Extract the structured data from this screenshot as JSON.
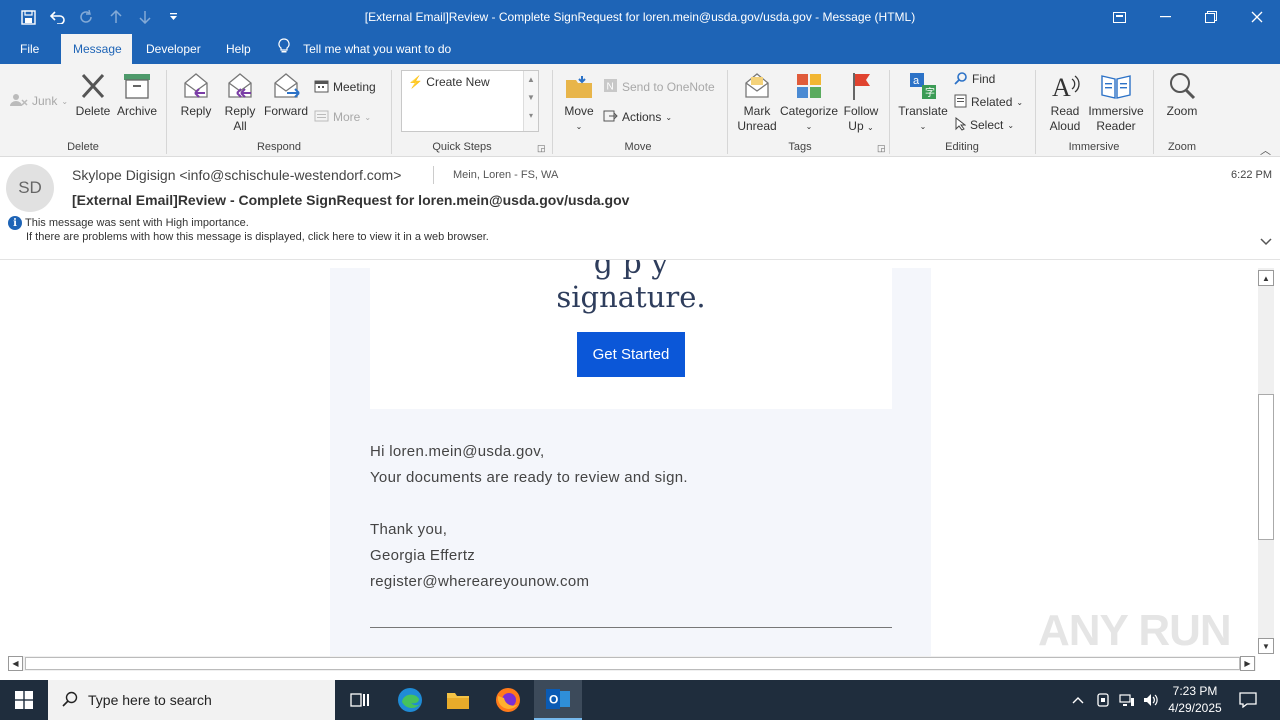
{
  "window": {
    "title": "[External Email]Review - Complete SignRequest for loren.mein@usda.gov/usda.gov  -  Message (HTML)"
  },
  "quick_access": [
    "save-icon",
    "undo-icon",
    "redo-icon",
    "up-arrow-icon",
    "down-arrow-icon",
    "customize-icon"
  ],
  "menu": {
    "tabs": [
      "File",
      "Message",
      "Developer",
      "Help"
    ],
    "active_tab": "Message",
    "tell_me": "Tell me what you want to do"
  },
  "ribbon": {
    "delete_group": {
      "label": "Delete",
      "junk": "Junk",
      "delete": "Delete",
      "archive": "Archive"
    },
    "respond_group": {
      "label": "Respond",
      "reply": "Reply",
      "reply_all_1": "Reply",
      "reply_all_2": "All",
      "forward": "Forward",
      "meeting": "Meeting",
      "more": "More"
    },
    "quicksteps_group": {
      "label": "Quick Steps",
      "create_new": "Create New"
    },
    "move_group": {
      "label": "Move",
      "move": "Move",
      "onenote": "Send to OneNote",
      "actions": "Actions"
    },
    "tags_group": {
      "label": "Tags",
      "mark_unread_1": "Mark",
      "mark_unread_2": "Unread",
      "categorize": "Categorize",
      "follow_up_1": "Follow",
      "follow_up_2": "Up"
    },
    "editing_group": {
      "label": "Editing",
      "translate": "Translate",
      "find": "Find",
      "related": "Related",
      "select": "Select"
    },
    "immersive_group": {
      "label": "Immersive",
      "read_aloud_1": "Read",
      "read_aloud_2": "Aloud",
      "immersive_reader_1": "Immersive",
      "immersive_reader_2": "Reader"
    },
    "zoom_group": {
      "label": "Zoom",
      "zoom": "Zoom"
    }
  },
  "message": {
    "avatar_initials": "SD",
    "from": "Skylope Digisign <info@schischule-westendorf.com>",
    "to": "Mein, Loren - FS, WA",
    "time": "6:22 PM",
    "subject": "[External Email]Review - Complete SignRequest for loren.mein@usda.gov/usda.gov",
    "importance": "This message was sent with High importance.",
    "display_note": "If there are problems with how this message is displayed, click here to view it in a web browser."
  },
  "email_body": {
    "partial_heading": "g                        p         y",
    "signature_line": "signature.",
    "cta": "Get Started",
    "lines": [
      "Hi loren.mein@usda.gov,",
      "Your documents are ready to review and sign.",
      "Thank you,",
      "Georgia Effertz",
      "register@whereareyounow.com"
    ]
  },
  "watermark": "ANY  RUN",
  "taskbar": {
    "search_placeholder": "Type here to search",
    "apps": [
      "task-view-icon",
      "edge-icon",
      "file-explorer-icon",
      "firefox-icon",
      "outlook-icon"
    ],
    "active_app": "outlook-icon",
    "clock_time": "7:23 PM",
    "clock_date": "4/29/2025"
  },
  "colors": {
    "titlebar": "#1e64b6",
    "ribbon_bg": "#f3f3f3",
    "cta": "#0b57d8",
    "taskbar": "#1f2d3d"
  }
}
